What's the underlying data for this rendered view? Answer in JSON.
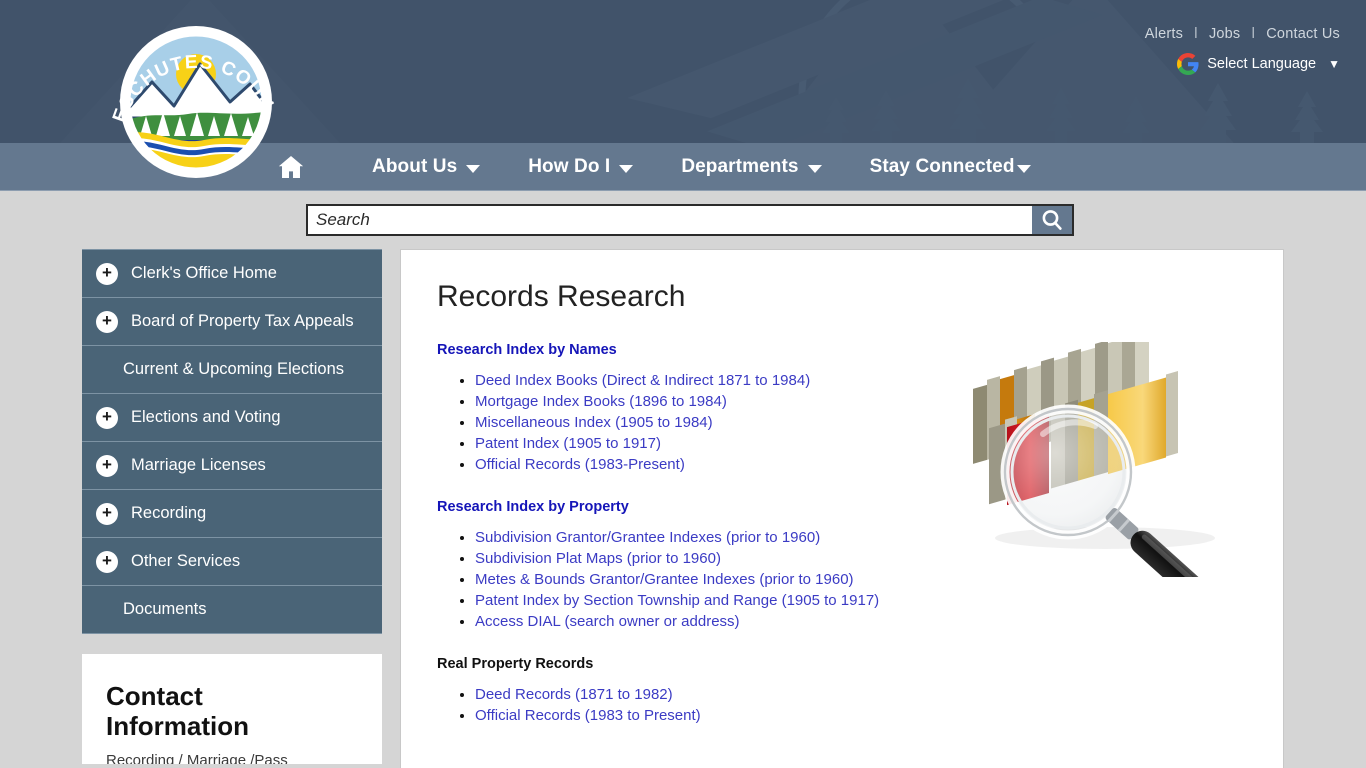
{
  "header": {
    "utility_links": [
      "Alerts",
      "Jobs",
      "Contact Us"
    ],
    "separator": "l",
    "language_label": "Select Language",
    "language_caret": "▼",
    "logo_text": "DESCHUTES COUNTY",
    "colors": {
      "header_bg": "#41536a",
      "nav_bg": "#64788f",
      "sidebar_bg": "#4a6477",
      "page_bg": "#d5d5d5",
      "link_blue": "#3b3bc4",
      "heading_blue": "#1515b8"
    }
  },
  "nav": {
    "home_label": "Home",
    "items": [
      {
        "label": "About Us",
        "has_caret": true
      },
      {
        "label": "How Do I",
        "has_caret": true
      },
      {
        "label": "Departments",
        "has_caret": true
      },
      {
        "label": "Stay Connected",
        "has_caret": true
      }
    ]
  },
  "search": {
    "placeholder": "Search",
    "value": "",
    "button_icon": "search-icon"
  },
  "sidebar": {
    "items": [
      {
        "label": "Clerk's Office Home",
        "expandable": true
      },
      {
        "label": "Board of Property Tax Appeals",
        "expandable": true
      },
      {
        "label": "Current & Upcoming Elections",
        "expandable": false
      },
      {
        "label": "Elections and Voting",
        "expandable": true
      },
      {
        "label": "Marriage Licenses",
        "expandable": true
      },
      {
        "label": "Recording",
        "expandable": true
      },
      {
        "label": "Other Services",
        "expandable": true
      },
      {
        "label": "Documents",
        "expandable": false
      }
    ],
    "expand_glyph": "+",
    "contact": {
      "title": "Contact Information",
      "subtitle": "Recording / Marriage /Pass"
    }
  },
  "main": {
    "title": "Records Research",
    "sections": [
      {
        "heading": "Research Index by Names",
        "heading_style": "blue",
        "links": [
          "Deed Index Books (Direct & Indirect 1871 to 1984)",
          "Mortgage Index Books (1896 to 1984)",
          "Miscellaneous Index (1905 to 1984)",
          "Patent Index (1905 to 1917)",
          "Official Records (1983-Present)"
        ]
      },
      {
        "heading": "Research Index by Property",
        "heading_style": "blue",
        "links": [
          "Subdivision Grantor/Grantee Indexes (prior to 1960)",
          "Subdivision Plat Maps (prior to 1960)",
          "Metes & Bounds Grantor/Grantee Indexes (prior to 1960)",
          "Patent Index by Section Township and Range (1905 to 1917)",
          "Access DIAL (search owner or address)"
        ]
      },
      {
        "heading": "Real Property Records",
        "heading_style": "dark",
        "links": [
          "Deed Records (1871 to 1982)",
          "Official Records (1983 to Present)"
        ]
      }
    ],
    "illustration": "magnifying-glass-over-file-folders"
  }
}
